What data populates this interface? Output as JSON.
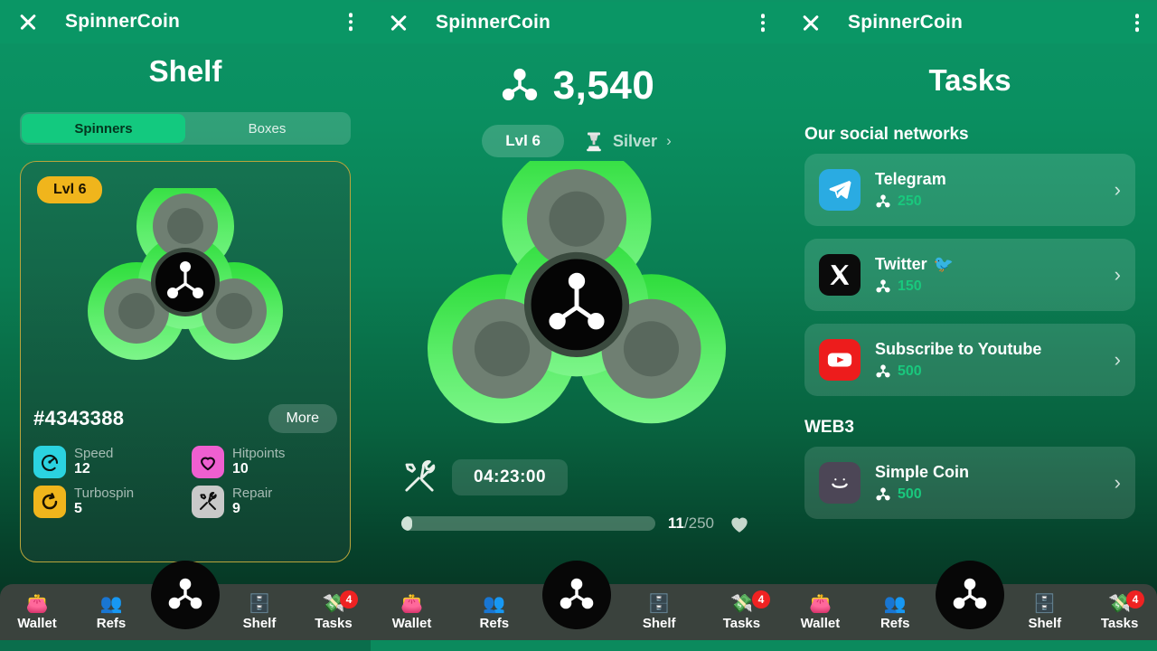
{
  "app": {
    "title": "SpinnerCoin",
    "close_icon": "close-icon",
    "menu_icon": "kebab-menu-icon"
  },
  "accent": {
    "green": "#13c97f",
    "reward_green": "#19c87d",
    "gold": "#f0b51c",
    "badge_red": "#ef2222",
    "card_border": "#b9a43c"
  },
  "shelf": {
    "page_title": "Shelf",
    "tabs": [
      {
        "label": "Spinners",
        "active": true
      },
      {
        "label": "Boxes",
        "active": false
      }
    ],
    "card": {
      "level_badge": "Lvl 6",
      "id": "#4343388",
      "more_label": "More",
      "stats": [
        {
          "label": "Speed",
          "value": "12",
          "icon": "speedometer-icon",
          "color": "#2bd3e0"
        },
        {
          "label": "Hitpoints",
          "value": "10",
          "icon": "heart-icon",
          "color": "#ef5fd0"
        },
        {
          "label": "Turbospin",
          "value": "5",
          "icon": "refresh-icon",
          "color": "#f0b51c"
        },
        {
          "label": "Repair",
          "value": "9",
          "icon": "tools-icon",
          "color": "#c9c9c9"
        }
      ]
    }
  },
  "home": {
    "balance": "3,540",
    "balance_icon": "spinner-coin-icon",
    "level_chip": "Lvl 6",
    "rank_name": "Silver",
    "rank_icon": "trophy-icon",
    "rank_chevron": "›",
    "repair_icon": "tools-icon",
    "timer": "04:23:00",
    "progress_current": "11",
    "progress_separator": "/",
    "progress_total": "250",
    "progress_percent": 4.4,
    "progress_icon": "heart-icon"
  },
  "tasks": {
    "page_title": "Tasks",
    "sections": [
      {
        "title": "Our social networks",
        "items": [
          {
            "name": "Telegram",
            "reward": "250",
            "icon": "telegram-icon",
            "suffix": "",
            "chevron": "›"
          },
          {
            "name": "Twitter",
            "reward": "150",
            "icon": "x-twitter-icon",
            "suffix": "🐦",
            "chevron": "›"
          },
          {
            "name": "Subscribe to Youtube",
            "reward": "500",
            "icon": "youtube-icon",
            "suffix": "",
            "chevron": "›"
          }
        ]
      },
      {
        "title": "WEB3",
        "items": [
          {
            "name": "Simple Coin",
            "reward": "500",
            "icon": "smiley-icon",
            "suffix": "",
            "chevron": "›"
          }
        ]
      }
    ]
  },
  "nav": {
    "items": [
      {
        "label": "Wallet",
        "emoji": "👛",
        "icon": "wallet-icon",
        "badge": ""
      },
      {
        "label": "Refs",
        "emoji": "👥",
        "icon": "refs-icon",
        "badge": ""
      },
      {
        "label": "Shelf",
        "emoji": "🗄️",
        "icon": "shelf-icon",
        "badge": ""
      },
      {
        "label": "Tasks",
        "emoji": "💸",
        "icon": "tasks-icon",
        "badge": "4"
      }
    ],
    "center_icon": "spinner-coin-icon"
  }
}
